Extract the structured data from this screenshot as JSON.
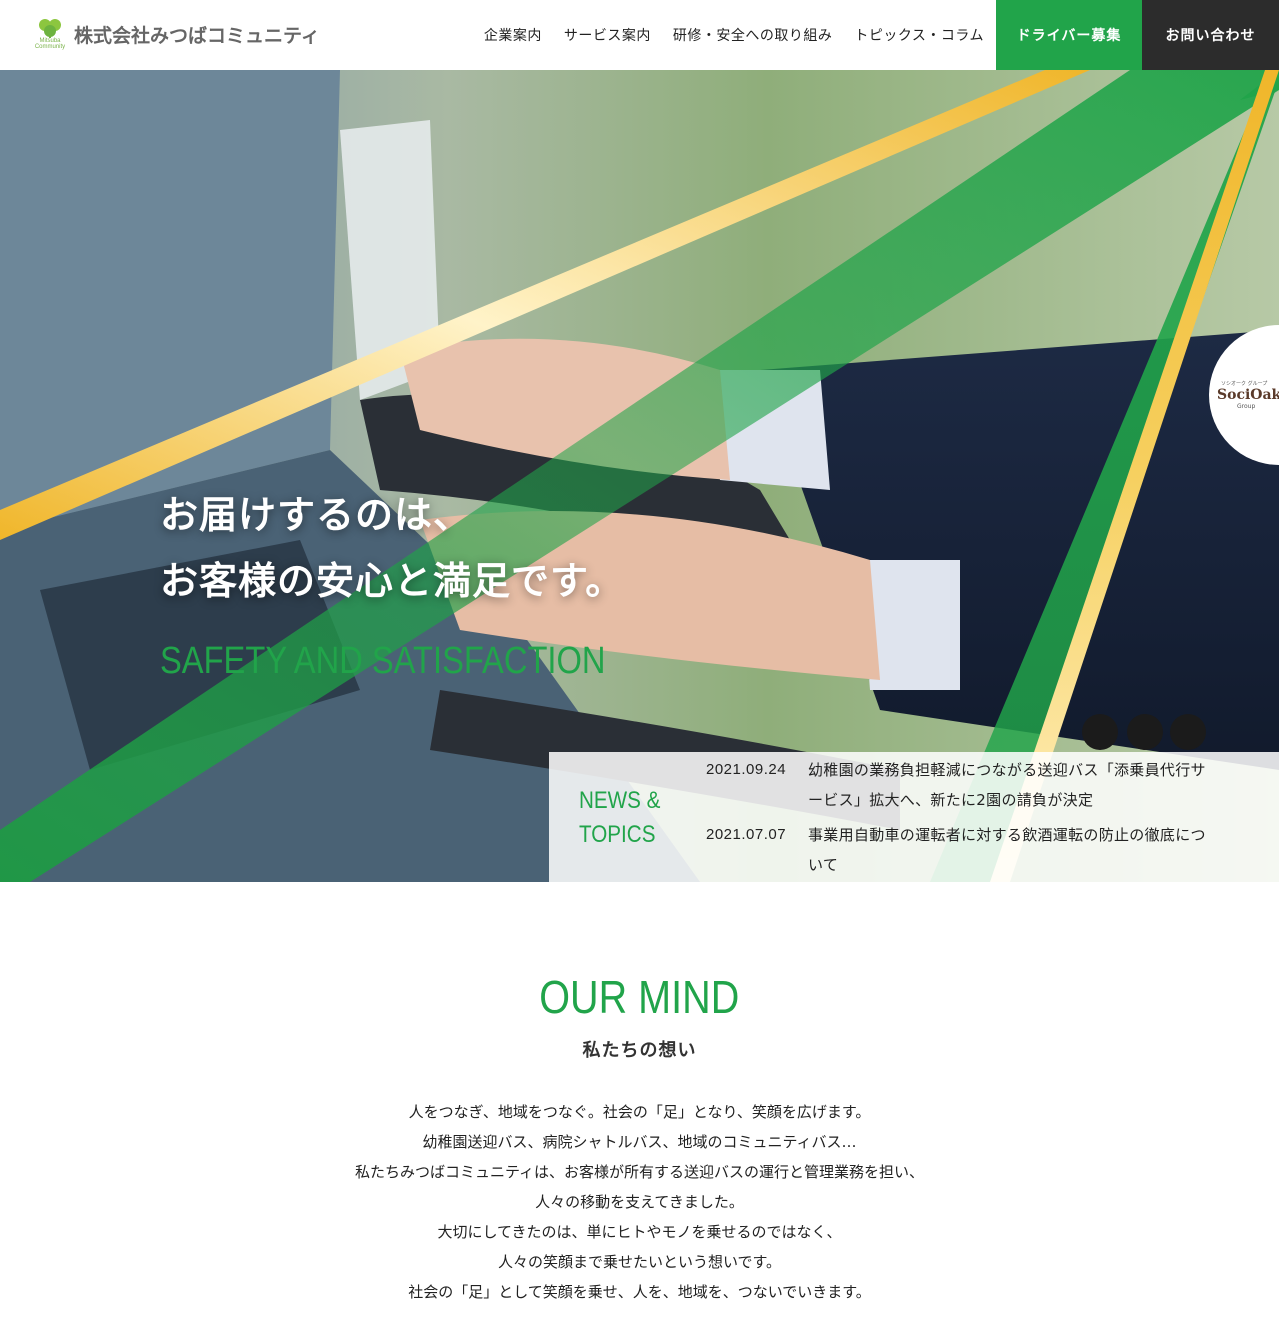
{
  "header": {
    "logo_text": "株式会社みつばコミュニティ",
    "logo_sub": "Mitsuba Community",
    "nav": [
      {
        "label": "企業案内"
      },
      {
        "label": "サービス案内"
      },
      {
        "label": "研修・安全への取り組み"
      },
      {
        "label": "トピックス・コラム"
      }
    ],
    "recruit_label": "ドライバー募集",
    "contact_label": "お問い合わせ"
  },
  "hero": {
    "copy_line1": "お届けするのは、",
    "copy_line2": "お客様の安心と満足です。",
    "copy_en": "SAFETY AND SATISFACTION",
    "group_badge": {
      "small": "ソシオーク グループ",
      "name": "SociOak",
      "group": "Group"
    }
  },
  "news": {
    "title_line1": "NEWS &",
    "title_line2": "TOPICS",
    "items": [
      {
        "date": "2021.09.24",
        "text": "幼稚園の業務負担軽減につながる送迎バス「添乗員代行サービス」拡大へ、新たに2園の請負が決定"
      },
      {
        "date": "2021.07.07",
        "text": "事業用自動車の運転者に対する飲酒運転の防止の徹底について"
      }
    ]
  },
  "mind": {
    "title": "OUR MIND",
    "subtitle": "私たちの想い",
    "lines": [
      "人をつなぎ、地域をつなぐ。社会の「足」となり、笑顔を広げます。",
      "幼稚園送迎バス、病院シャトルバス、地域のコミュニティバス…",
      "私たちみつばコミュニティは、お客様が所有する送迎バスの運行と管理業務を担い、",
      "人々の移動を支えてきました。",
      "大切にしてきたのは、単にヒトやモノを乗せるのではなく、",
      "人々の笑顔まで乗せたいという想いです。",
      "社会の「足」として笑顔を乗せ、人を、地域を、つないでいきます。"
    ]
  },
  "colors": {
    "brand_green": "#21a44a",
    "accent_yellow": "#f0b62a",
    "dark": "#2c2c2c"
  },
  "icons": {
    "logo": "clover-icon"
  }
}
